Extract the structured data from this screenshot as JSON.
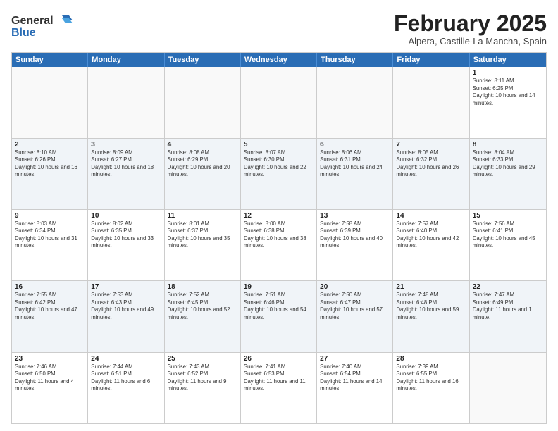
{
  "logo": {
    "line1": "General",
    "line2": "Blue"
  },
  "title": "February 2025",
  "subtitle": "Alpera, Castille-La Mancha, Spain",
  "days": [
    "Sunday",
    "Monday",
    "Tuesday",
    "Wednesday",
    "Thursday",
    "Friday",
    "Saturday"
  ],
  "weeks": [
    [
      {
        "day": "",
        "text": ""
      },
      {
        "day": "",
        "text": ""
      },
      {
        "day": "",
        "text": ""
      },
      {
        "day": "",
        "text": ""
      },
      {
        "day": "",
        "text": ""
      },
      {
        "day": "",
        "text": ""
      },
      {
        "day": "1",
        "text": "Sunrise: 8:11 AM\nSunset: 6:25 PM\nDaylight: 10 hours and 14 minutes."
      }
    ],
    [
      {
        "day": "2",
        "text": "Sunrise: 8:10 AM\nSunset: 6:26 PM\nDaylight: 10 hours and 16 minutes."
      },
      {
        "day": "3",
        "text": "Sunrise: 8:09 AM\nSunset: 6:27 PM\nDaylight: 10 hours and 18 minutes."
      },
      {
        "day": "4",
        "text": "Sunrise: 8:08 AM\nSunset: 6:29 PM\nDaylight: 10 hours and 20 minutes."
      },
      {
        "day": "5",
        "text": "Sunrise: 8:07 AM\nSunset: 6:30 PM\nDaylight: 10 hours and 22 minutes."
      },
      {
        "day": "6",
        "text": "Sunrise: 8:06 AM\nSunset: 6:31 PM\nDaylight: 10 hours and 24 minutes."
      },
      {
        "day": "7",
        "text": "Sunrise: 8:05 AM\nSunset: 6:32 PM\nDaylight: 10 hours and 26 minutes."
      },
      {
        "day": "8",
        "text": "Sunrise: 8:04 AM\nSunset: 6:33 PM\nDaylight: 10 hours and 29 minutes."
      }
    ],
    [
      {
        "day": "9",
        "text": "Sunrise: 8:03 AM\nSunset: 6:34 PM\nDaylight: 10 hours and 31 minutes."
      },
      {
        "day": "10",
        "text": "Sunrise: 8:02 AM\nSunset: 6:35 PM\nDaylight: 10 hours and 33 minutes."
      },
      {
        "day": "11",
        "text": "Sunrise: 8:01 AM\nSunset: 6:37 PM\nDaylight: 10 hours and 35 minutes."
      },
      {
        "day": "12",
        "text": "Sunrise: 8:00 AM\nSunset: 6:38 PM\nDaylight: 10 hours and 38 minutes."
      },
      {
        "day": "13",
        "text": "Sunrise: 7:58 AM\nSunset: 6:39 PM\nDaylight: 10 hours and 40 minutes."
      },
      {
        "day": "14",
        "text": "Sunrise: 7:57 AM\nSunset: 6:40 PM\nDaylight: 10 hours and 42 minutes."
      },
      {
        "day": "15",
        "text": "Sunrise: 7:56 AM\nSunset: 6:41 PM\nDaylight: 10 hours and 45 minutes."
      }
    ],
    [
      {
        "day": "16",
        "text": "Sunrise: 7:55 AM\nSunset: 6:42 PM\nDaylight: 10 hours and 47 minutes."
      },
      {
        "day": "17",
        "text": "Sunrise: 7:53 AM\nSunset: 6:43 PM\nDaylight: 10 hours and 49 minutes."
      },
      {
        "day": "18",
        "text": "Sunrise: 7:52 AM\nSunset: 6:45 PM\nDaylight: 10 hours and 52 minutes."
      },
      {
        "day": "19",
        "text": "Sunrise: 7:51 AM\nSunset: 6:46 PM\nDaylight: 10 hours and 54 minutes."
      },
      {
        "day": "20",
        "text": "Sunrise: 7:50 AM\nSunset: 6:47 PM\nDaylight: 10 hours and 57 minutes."
      },
      {
        "day": "21",
        "text": "Sunrise: 7:48 AM\nSunset: 6:48 PM\nDaylight: 10 hours and 59 minutes."
      },
      {
        "day": "22",
        "text": "Sunrise: 7:47 AM\nSunset: 6:49 PM\nDaylight: 11 hours and 1 minute."
      }
    ],
    [
      {
        "day": "23",
        "text": "Sunrise: 7:46 AM\nSunset: 6:50 PM\nDaylight: 11 hours and 4 minutes."
      },
      {
        "day": "24",
        "text": "Sunrise: 7:44 AM\nSunset: 6:51 PM\nDaylight: 11 hours and 6 minutes."
      },
      {
        "day": "25",
        "text": "Sunrise: 7:43 AM\nSunset: 6:52 PM\nDaylight: 11 hours and 9 minutes."
      },
      {
        "day": "26",
        "text": "Sunrise: 7:41 AM\nSunset: 6:53 PM\nDaylight: 11 hours and 11 minutes."
      },
      {
        "day": "27",
        "text": "Sunrise: 7:40 AM\nSunset: 6:54 PM\nDaylight: 11 hours and 14 minutes."
      },
      {
        "day": "28",
        "text": "Sunrise: 7:39 AM\nSunset: 6:55 PM\nDaylight: 11 hours and 16 minutes."
      },
      {
        "day": "",
        "text": ""
      }
    ]
  ]
}
